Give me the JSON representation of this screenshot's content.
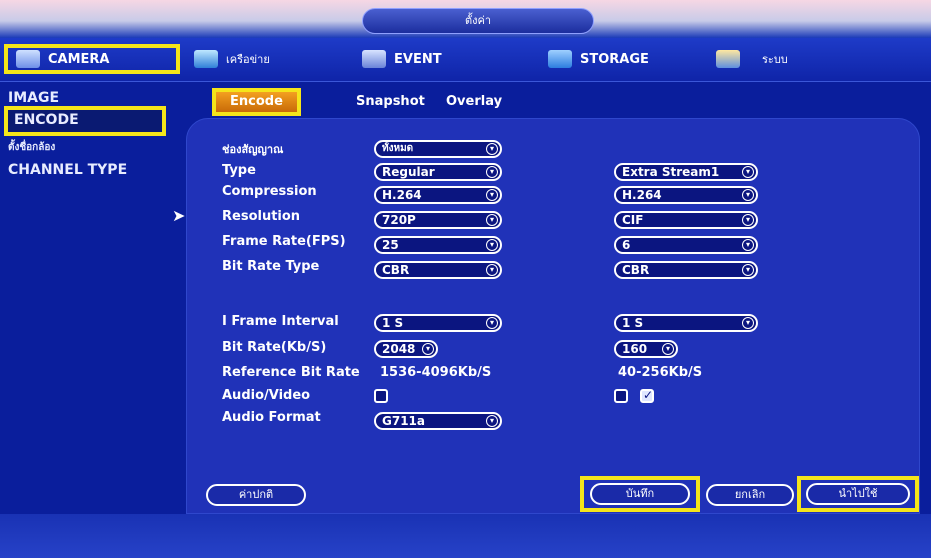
{
  "window": {
    "title": "ตั้งค่า"
  },
  "tabs": [
    {
      "label": "CAMERA",
      "icon": "camera-icon"
    },
    {
      "label": "เครือข่าย",
      "icon": "network-icon"
    },
    {
      "label": "EVENT",
      "icon": "event-icon"
    },
    {
      "label": "STORAGE",
      "icon": "storage-icon"
    },
    {
      "label": "ระบบ",
      "icon": "system-icon"
    }
  ],
  "sidebar": {
    "items": [
      {
        "label": "IMAGE"
      },
      {
        "label": "ENCODE"
      },
      {
        "label": "ตั้งชื่อกล้อง"
      },
      {
        "label": "CHANNEL TYPE"
      }
    ]
  },
  "subtabs": [
    {
      "label": "Encode"
    },
    {
      "label": "Snapshot"
    },
    {
      "label": "Overlay"
    }
  ],
  "form": {
    "channel": {
      "label": "ช่องสัญญาณ",
      "value": "ทั้งหมด"
    },
    "type": {
      "label": "Type",
      "main": "Regular",
      "extra": "Extra Stream1"
    },
    "compression": {
      "label": "Compression",
      "main": "H.264",
      "extra": "H.264"
    },
    "resolution": {
      "label": "Resolution",
      "main": "720P",
      "extra": "CIF"
    },
    "frame_rate": {
      "label": "Frame Rate(FPS)",
      "main": "25",
      "extra": "6"
    },
    "bit_rate_type": {
      "label": "Bit Rate Type",
      "main": "CBR",
      "extra": "CBR"
    },
    "i_frame": {
      "label": "I Frame Interval",
      "main": "1 S",
      "extra": "1 S"
    },
    "bit_rate": {
      "label": "Bit Rate(Kb/S)",
      "main": "2048",
      "extra": "160"
    },
    "reference": {
      "label": "Reference Bit Rate",
      "main": "1536-4096Kb/S",
      "extra": "40-256Kb/S"
    },
    "audio_video": {
      "label": "Audio/Video",
      "main_checked": false,
      "extra_checked": [
        false,
        true
      ]
    },
    "audio_format": {
      "label": "Audio Format",
      "main": "G711a"
    }
  },
  "buttons": {
    "default": "ค่าปกติ",
    "save": "บันทึก",
    "cancel": "ยกเลิก",
    "apply": "นำไปใช้"
  },
  "colors": {
    "highlight": "#f5e51a",
    "active_tab": "#f3a020",
    "background": "#0a1e9c"
  }
}
